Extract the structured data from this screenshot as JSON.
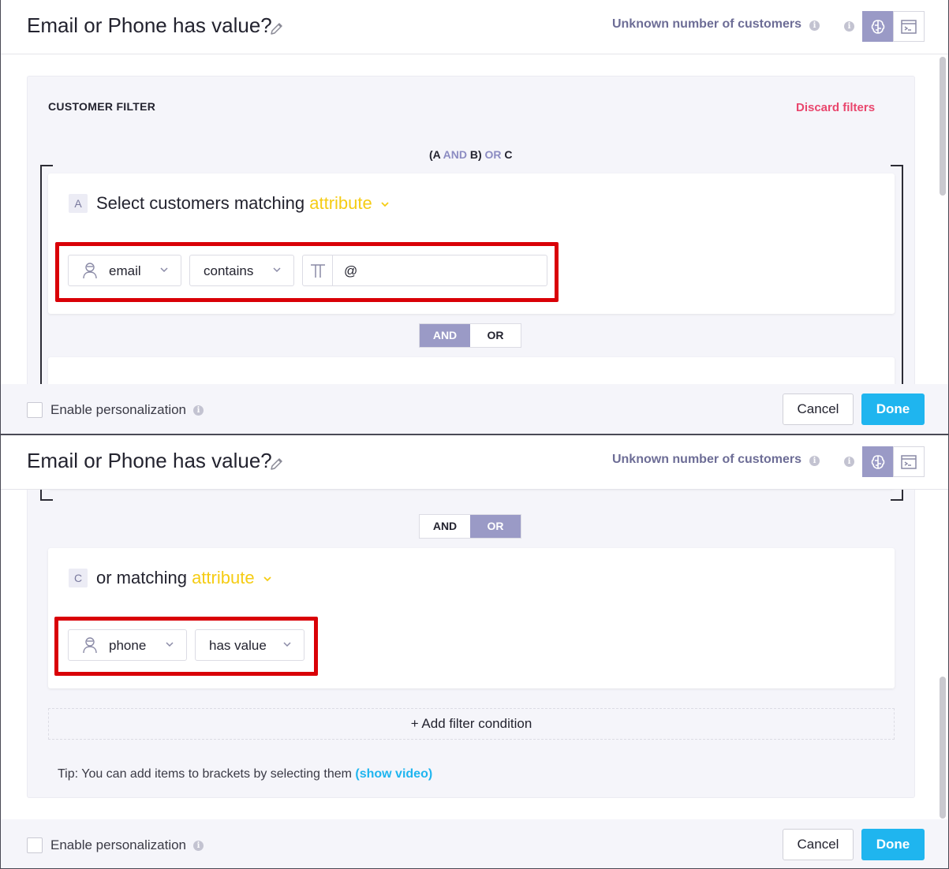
{
  "header": {
    "title": "Email or Phone has value?",
    "customers_label": "Unknown number of customers",
    "info_glyph": "i"
  },
  "filter": {
    "section_title": "CUSTOMER FILTER",
    "discard_label": "Discard filters",
    "expression": {
      "open": "(A ",
      "and": "AND",
      "mid": " B) ",
      "or": "OR",
      "end": " C"
    },
    "conditions": [
      {
        "letter": "A",
        "prefix": "Select customers matching",
        "type_label": "attribute",
        "attribute": "email",
        "operator": "contains",
        "value": "@"
      },
      {
        "letter": "C",
        "prefix": "or matching",
        "type_label": "attribute",
        "attribute": "phone",
        "operator": "has value"
      }
    ],
    "connector": {
      "and": "AND",
      "or": "OR"
    },
    "add_condition_label": "+ Add filter condition",
    "tip_text": "Tip: You can add items to brackets by selecting them ",
    "tip_link": "(show video)"
  },
  "footer": {
    "personalization_label": "Enable personalization",
    "cancel_label": "Cancel",
    "done_label": "Done"
  },
  "icons": {
    "pencil": "pencil-icon",
    "info": "info-icon",
    "brain": "brain-icon",
    "terminal": "terminal-icon",
    "person": "person-icon",
    "chevron": "chevron-down-icon",
    "text_type": "text-type-icon"
  },
  "colors": {
    "accent_purple": "#9a9ac6",
    "attribute_yellow": "#f5cc14",
    "discard_red": "#e9466d",
    "done_blue": "#1fb5ef",
    "highlight_red": "#d90007"
  }
}
